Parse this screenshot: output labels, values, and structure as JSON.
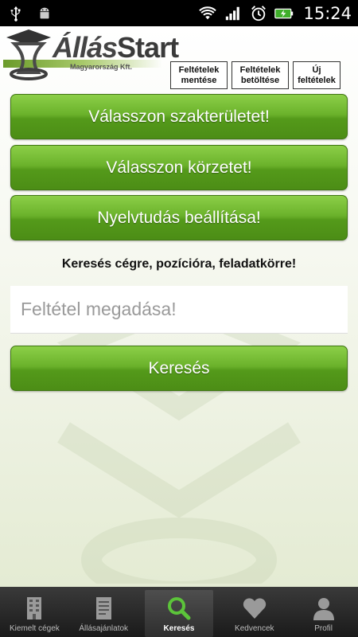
{
  "status_bar": {
    "time": "15:24"
  },
  "header": {
    "logo_main": "Állás",
    "logo_accent": "Start",
    "logo_sub": "Magyarország Kft.",
    "buttons": [
      {
        "label": "Feltételek mentése"
      },
      {
        "label": "Feltételek betöltése"
      },
      {
        "label": "Új feltételek"
      }
    ]
  },
  "main": {
    "select_field_button": "Válasszon szakterületet!",
    "select_area_button": "Válasszon körzetet!",
    "language_button": "Nyelvtudás beállítása!",
    "search_prompt": "Keresés cégre, pozícióra, feladatkörre!",
    "search_placeholder": "Feltétel megadása!",
    "search_button": "Keresés"
  },
  "tabbar": {
    "tabs": [
      {
        "label": "Kiemelt cégek",
        "icon": "building-icon"
      },
      {
        "label": "Állásajánlatok",
        "icon": "document-icon"
      },
      {
        "label": "Keresés",
        "icon": "search-icon",
        "active": true
      },
      {
        "label": "Kedvencek",
        "icon": "heart-icon"
      },
      {
        "label": "Profil",
        "icon": "person-icon"
      }
    ]
  },
  "colors": {
    "accent": "#62a824",
    "active_icon": "#5cc43a"
  }
}
